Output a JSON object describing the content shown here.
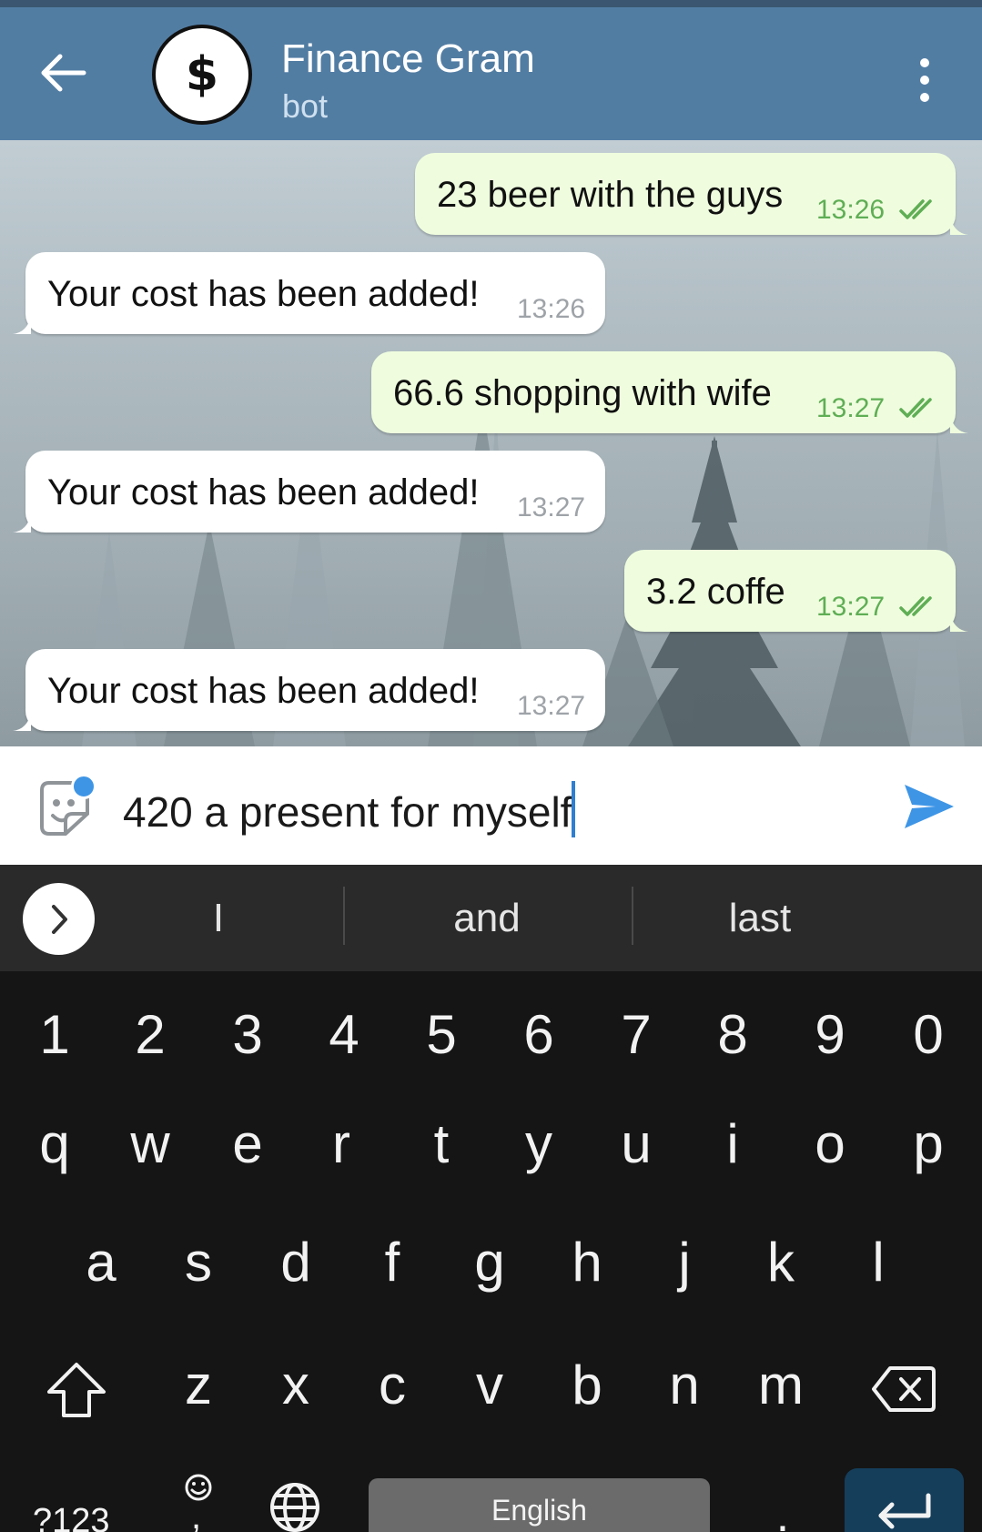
{
  "header": {
    "title": "Finance Gram",
    "subtitle": "bot",
    "avatar_symbol": "$",
    "bg_color": "#527da3"
  },
  "messages": [
    {
      "dir": "out",
      "text": "23 beer with the guys",
      "time": "13:26",
      "status": "read"
    },
    {
      "dir": "in",
      "text": "Your cost has been added!",
      "time": "13:26"
    },
    {
      "dir": "out",
      "text": "66.6 shopping with wife",
      "time": "13:27",
      "status": "read"
    },
    {
      "dir": "in",
      "text": "Your cost has been added!",
      "time": "13:27"
    },
    {
      "dir": "out",
      "text": "3.2 coffe",
      "time": "13:27",
      "status": "read"
    },
    {
      "dir": "in",
      "text": "Your cost has been added!",
      "time": "13:27"
    }
  ],
  "composer": {
    "value": "420 a present for myself",
    "send_icon": "send-icon",
    "sticker_icon": "sticker-icon"
  },
  "suggestions": [
    "I",
    "and",
    "last"
  ],
  "keyboard": {
    "numbers": [
      "1",
      "2",
      "3",
      "4",
      "5",
      "6",
      "7",
      "8",
      "9",
      "0"
    ],
    "row1": [
      "q",
      "w",
      "e",
      "r",
      "t",
      "y",
      "u",
      "i",
      "o",
      "p"
    ],
    "row2": [
      "a",
      "s",
      "d",
      "f",
      "g",
      "h",
      "j",
      "k",
      "l"
    ],
    "row3": [
      "z",
      "x",
      "c",
      "v",
      "b",
      "n",
      "m"
    ],
    "symbols_label": "?123",
    "comma_label": ",",
    "period_label": ".",
    "space_label": "English",
    "enter_color": "#153e5b"
  }
}
